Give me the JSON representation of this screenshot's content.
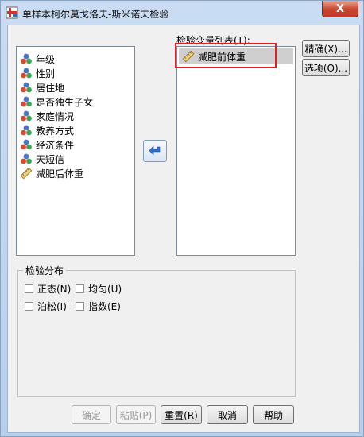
{
  "window": {
    "title": "单样本柯尔莫戈洛夫-斯米诺夫检验",
    "close_label": "X"
  },
  "source_list": {
    "items": [
      {
        "label": "年级",
        "icon": "nominal-variable-icon"
      },
      {
        "label": "性别",
        "icon": "nominal-variable-icon"
      },
      {
        "label": "居住地",
        "icon": "nominal-variable-icon"
      },
      {
        "label": "是否独生子女",
        "icon": "nominal-variable-icon"
      },
      {
        "label": "家庭情况",
        "icon": "nominal-variable-icon"
      },
      {
        "label": "教养方式",
        "icon": "nominal-variable-icon"
      },
      {
        "label": "经济条件",
        "icon": "nominal-variable-icon"
      },
      {
        "label": "天短信",
        "icon": "nominal-variable-icon"
      },
      {
        "label": "减肥后体重",
        "icon": "scale-variable-icon"
      }
    ]
  },
  "test_list": {
    "label": "检验变量列表(T):",
    "items": [
      {
        "label": "减肥前体重",
        "icon": "scale-variable-icon"
      }
    ]
  },
  "side_buttons": {
    "exact": "精确(X)...",
    "options": "选项(O)..."
  },
  "distribution": {
    "title": "检验分布",
    "normal": "正态(N)",
    "uniform": "均匀(U)",
    "poisson": "泊松(I)",
    "exponential": "指数(E)"
  },
  "buttons": {
    "ok": "确定",
    "paste": "粘贴(P)",
    "reset": "重置(R)",
    "cancel": "取消",
    "help": "帮助"
  }
}
